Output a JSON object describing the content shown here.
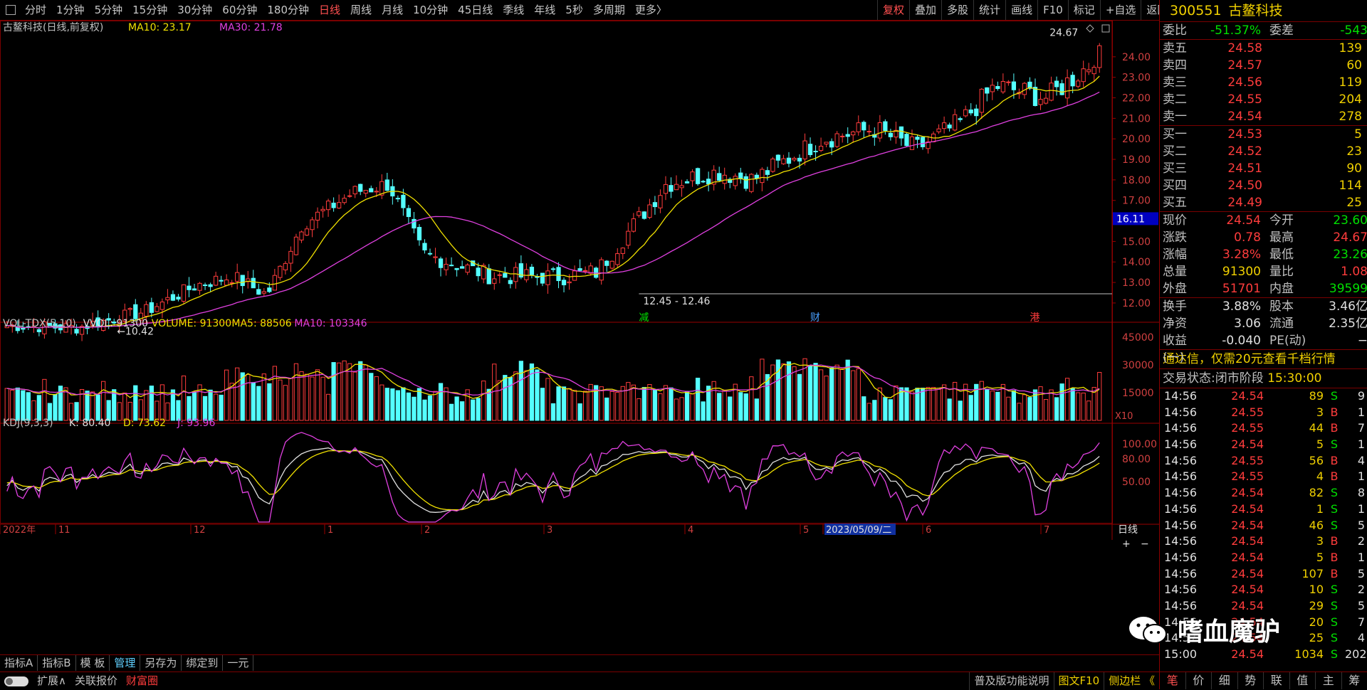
{
  "toolbar": {
    "periods": [
      "分时",
      "1分钟",
      "5分钟",
      "15分钟",
      "30分钟",
      "60分钟",
      "180分钟",
      "日线",
      "周线",
      "月线",
      "10分钟",
      "45日线",
      "季线",
      "年线",
      "5秒",
      "多周期",
      "更多〉"
    ],
    "active": "日线",
    "right_buttons": [
      "复权",
      "叠加",
      "多股",
      "统计",
      "画线",
      "F10",
      "标记",
      "+自选",
      "返回"
    ],
    "right_active": "复权"
  },
  "main_chart": {
    "title": "古鳌科技(日线,前复权)",
    "ma10_label": "MA10: 23.17",
    "ma30_label": "MA30: 21.78",
    "high_label": "24.67",
    "low_label": "12.45 - 12.46",
    "left_low_label": "10.42",
    "cursor_price": "16.11",
    "events": [
      "减",
      "财",
      "港"
    ],
    "colors": {
      "up": "#ff3c3c",
      "down": "#54ffff",
      "ma10": "#f0e000",
      "ma30": "#e040e0"
    }
  },
  "vol_chart": {
    "title": "VOL-TDX(5,10)",
    "vvol": "VVOL: 91300",
    "volume": "VOLUME: 91300",
    "ma5": "MA5: 88506",
    "ma10": "MA10: 103346",
    "unit": "X10"
  },
  "kdj_chart": {
    "title": "KDJ(9,3,3)",
    "k": "K: 80.40",
    "d": "D: 73.62",
    "j": "J: 93.96"
  },
  "time_axis": {
    "labels": [
      "2022年",
      "11",
      "12",
      "1",
      "2",
      "3",
      "4",
      "5",
      "2023/05/09/二",
      "6",
      "7"
    ],
    "period": "日线",
    "plus": "+",
    "minus": "−"
  },
  "chart_data": [
    {
      "type": "candlestick",
      "title": "古鳌科技(日线,前复权)",
      "y_ticks": [
        12.0,
        13.0,
        14.0,
        15.0,
        16.0,
        17.0,
        18.0,
        19.0,
        20.0,
        21.0,
        22.0,
        23.0,
        24.0
      ],
      "ylim": [
        11.2,
        25.0
      ],
      "monthly_anchor_closes": {
        "2022-10": 10.8,
        "2022-11": 11.6,
        "2022-12": 13.3,
        "2023-01": 12.4,
        "2023-02": 17.6,
        "2023-03": 13.5,
        "2023-04": 13.3,
        "2023-05": 18.0,
        "2023-06": 20.7,
        "2023-07": 24.54
      },
      "extremes": {
        "high": 24.67,
        "low_a": 12.45,
        "low_b": 12.46,
        "early_low": 10.42
      }
    },
    {
      "type": "bar",
      "title": "VOL-TDX(5,10)",
      "y_ticks": [
        15000,
        30000,
        45000
      ],
      "ylim": [
        0,
        50000
      ],
      "last_volume": 91300,
      "ma5": 88506,
      "ma10": 103346
    },
    {
      "type": "line",
      "title": "KDJ(9,3,3)",
      "y_ticks": [
        50.0,
        80.0,
        100.0
      ],
      "ylim": [
        -5,
        120
      ],
      "last": {
        "K": 80.4,
        "D": 73.62,
        "J": 93.96
      }
    }
  ],
  "bottom_tabs": [
    "指标A",
    "指标B",
    "模 板",
    "管理",
    "另存为",
    "绑定到",
    "一元"
  ],
  "bottom_tabs_active": "管理",
  "status_bar": {
    "left": [
      "扩展∧",
      "关联报价",
      "财富圈"
    ],
    "right": [
      "普及版功能说明",
      "图文F10",
      "侧边栏 《"
    ]
  },
  "quote": {
    "code": "300551",
    "name": "古鳌科技",
    "weibi_label": "委比",
    "weibi": "-51.37%",
    "weicha_label": "委差",
    "weicha": "-543",
    "asks": [
      {
        "label": "卖五",
        "price": "24.58",
        "vol": "139"
      },
      {
        "label": "卖四",
        "price": "24.57",
        "vol": "60"
      },
      {
        "label": "卖三",
        "price": "24.56",
        "vol": "119"
      },
      {
        "label": "卖二",
        "price": "24.55",
        "vol": "204"
      },
      {
        "label": "卖一",
        "price": "24.54",
        "vol": "278"
      }
    ],
    "bids": [
      {
        "label": "买一",
        "price": "24.53",
        "vol": "5"
      },
      {
        "label": "买二",
        "price": "24.52",
        "vol": "23"
      },
      {
        "label": "买三",
        "price": "24.51",
        "vol": "90"
      },
      {
        "label": "买四",
        "price": "24.50",
        "vol": "114"
      },
      {
        "label": "买五",
        "price": "24.49",
        "vol": "25"
      }
    ],
    "stats": [
      {
        "l1": "现价",
        "v1": "24.54",
        "c1": "red",
        "l2": "今开",
        "v2": "23.60",
        "c2": "green"
      },
      {
        "l1": "涨跌",
        "v1": "0.78",
        "c1": "red",
        "l2": "最高",
        "v2": "24.67",
        "c2": "red"
      },
      {
        "l1": "涨幅",
        "v1": "3.28%",
        "c1": "red",
        "l2": "最低",
        "v2": "23.26",
        "c2": "green"
      },
      {
        "l1": "总量",
        "v1": "91300",
        "c1": "yellow",
        "l2": "量比",
        "v2": "1.08",
        "c2": "red"
      },
      {
        "l1": "外盘",
        "v1": "51701",
        "c1": "red",
        "l2": "内盘",
        "v2": "39599",
        "c2": "green"
      }
    ],
    "stats2": [
      {
        "l1": "换手",
        "v1": "3.88%",
        "c1": "white",
        "l2": "股本",
        "v2": "3.46亿",
        "c2": "white"
      },
      {
        "l1": "净资",
        "v1": "3.06",
        "c1": "white",
        "l2": "流通",
        "v2": "2.35亿",
        "c2": "white"
      },
      {
        "l1": "收益(一)",
        "v1": "-0.040",
        "c1": "white",
        "l2": "PE(动)",
        "v2": "−",
        "c2": "white"
      }
    ],
    "notice": "通达信，仅需20元查看千档行情",
    "status_label": "交易状态:",
    "status_value": "闭市阶段",
    "status_time": "15:30:00"
  },
  "ticks": [
    {
      "t": "14:56",
      "p": "24.54",
      "v": "89",
      "bs": "S",
      "c": "9"
    },
    {
      "t": "14:56",
      "p": "24.55",
      "v": "3",
      "bs": "B",
      "c": "1"
    },
    {
      "t": "14:56",
      "p": "24.55",
      "v": "44",
      "bs": "B",
      "c": "7"
    },
    {
      "t": "14:56",
      "p": "24.54",
      "v": "5",
      "bs": "S",
      "c": "1"
    },
    {
      "t": "14:56",
      "p": "24.55",
      "v": "56",
      "bs": "B",
      "c": "4"
    },
    {
      "t": "14:56",
      "p": "24.55",
      "v": "4",
      "bs": "B",
      "c": "1"
    },
    {
      "t": "14:56",
      "p": "24.54",
      "v": "82",
      "bs": "S",
      "c": "8"
    },
    {
      "t": "14:56",
      "p": "24.54",
      "v": "1",
      "bs": "S",
      "c": "1"
    },
    {
      "t": "14:56",
      "p": "24.54",
      "v": "46",
      "bs": "S",
      "c": "5"
    },
    {
      "t": "14:56",
      "p": "24.54",
      "v": "3",
      "bs": "B",
      "c": "2"
    },
    {
      "t": "14:56",
      "p": "24.54",
      "v": "5",
      "bs": "B",
      "c": "1"
    },
    {
      "t": "14:56",
      "p": "24.54",
      "v": "107",
      "bs": "B",
      "c": "5"
    },
    {
      "t": "14:56",
      "p": "24.54",
      "v": "10",
      "bs": "S",
      "c": "2"
    },
    {
      "t": "14:56",
      "p": "24.54",
      "v": "29",
      "bs": "S",
      "c": "5"
    },
    {
      "t": "14:56",
      "p": "24.54",
      "v": "20",
      "bs": "S",
      "c": "7"
    },
    {
      "t": "14:57",
      "p": "24.54",
      "v": "25",
      "bs": "S",
      "c": "4"
    },
    {
      "t": "15:00",
      "p": "24.54",
      "v": "1034",
      "bs": "S",
      "c": "202"
    }
  ],
  "right_bottom_tabs": [
    "笔",
    "价",
    "细",
    "势",
    "联",
    "值",
    "主",
    "筹"
  ],
  "right_bottom_active": "笔",
  "watermark": "嗜血魔驴"
}
